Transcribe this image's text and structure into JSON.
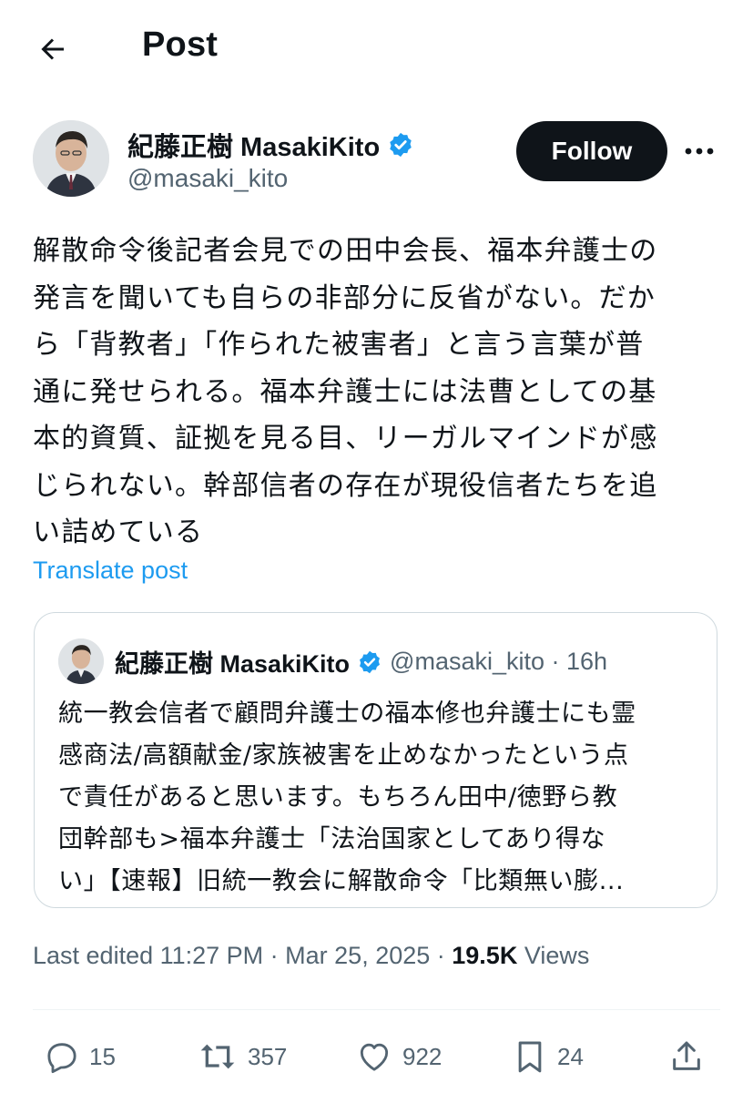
{
  "header": {
    "title": "Post"
  },
  "author": {
    "name": "紀藤正樹 MasakiKito",
    "handle": "@masaki_kito",
    "verified": true
  },
  "follow_label": "Follow",
  "post": {
    "text": "解散命令後記者会見での田中会長、福本弁護士の\n発言を聞いても自らの非部分に反省がない。だか\nら「背教者」「作られた被害者」と言う言葉が普\n通に発せられる。福本弁護士には法曹としての基\n本的資質、証拠を見る目、リーガルマインドが感\nじられない。幹部信者の存在が現役信者たちを追\nい詰めている",
    "translate_label": "Translate post"
  },
  "quote": {
    "name": "紀藤正樹 MasakiKito",
    "handle": "@masaki_kito · 16h",
    "text": "統一教会信者で顧問弁護士の福本修也弁護士にも霊\n感商法/高額献金/家族被害を止めなかったという点\nで責任があると思います。もちろん田中/徳野ら教\n団幹部も>福本弁護士「法治国家としてあり得な\nい」【速報】旧統一教会に解散命令「比類無い膨..."
  },
  "meta": {
    "edited": "Last edited 11:27 PM · Mar 25, 2025 · ",
    "views_count": "19.5K",
    "views_label": " Views"
  },
  "actions": {
    "replies": "15",
    "reposts": "357",
    "likes": "922",
    "bookmarks": "24"
  },
  "colors": {
    "accent": "#1d9bf0",
    "text": "#0f1419",
    "secondary": "#536471",
    "border": "#cfd9de"
  },
  "icons": [
    "back-arrow-icon",
    "verified-badge-icon",
    "more-icon",
    "reply-icon",
    "repost-icon",
    "like-icon",
    "bookmark-icon",
    "share-icon"
  ]
}
